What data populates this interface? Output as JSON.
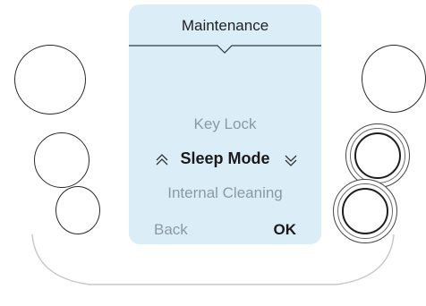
{
  "screen": {
    "title": "Maintenance",
    "items": {
      "above": "Key Lock",
      "selected": "Sleep Mode",
      "below": "Internal Cleaning"
    },
    "softkeys": {
      "left": "Back",
      "right": "OK"
    },
    "icons": {
      "up": "double-chevron-up-icon",
      "down": "double-chevron-down-icon"
    }
  },
  "colors": {
    "screen_background": "#dbeef8",
    "selected_text": "#1a1a1a",
    "dim_text": "#8c99a3",
    "outline": "#2a2a2a"
  }
}
